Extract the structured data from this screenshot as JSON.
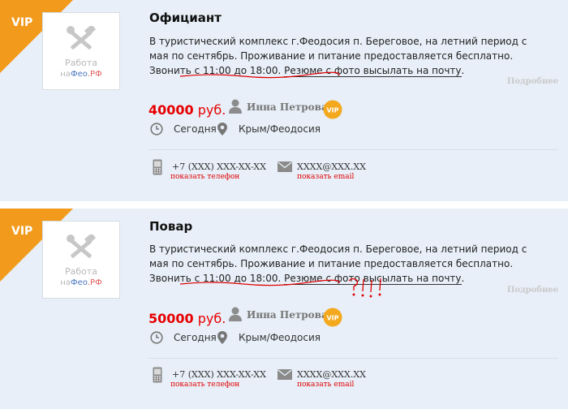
{
  "colors": {
    "vip_ribbon": "#f29a1c",
    "card_bg": "#e8eff8",
    "price": "#e60000",
    "link_red": "#e00000",
    "annotation": "#e00000"
  },
  "logo": {
    "line1": "Работа",
    "na": "на",
    "feo": "Фео",
    "rf": ".РФ",
    "icon": "tools-icon"
  },
  "listings": [
    {
      "vip": "VIP",
      "title": "Официант",
      "desc_before": "В туристический комплекс г.Феодосия п. Береговое, на летний период с мая по сентябрь. Проживание и питание предоставляется бесплатно. Звонить с 11:00 до 18:00. ",
      "desc_highlight": "Резюме с фото высылать на почту",
      "desc_after": ".",
      "more": "Подробнее",
      "price_value": "40000",
      "price_unit": "руб.",
      "person": "Инна Петрова",
      "person_badge": "VIP",
      "date": "Сегодня",
      "location": "Крым/Феодосия",
      "phone": "+7 (XXX) XXX-XX-XX",
      "show_phone": "показать телефон",
      "email": "XXXX@XXX.XX",
      "show_email": "показать email"
    },
    {
      "vip": "VIP",
      "title": "Повар",
      "desc_before": "В туристический комплекс  г.Феодосия п. Береговое, на летний период с мая по сентябрь. Проживание и питание предоставляется бесплатно.  Звонить с 11:00 до 18:00. ",
      "desc_highlight": "Резюме с фото высылать на почту",
      "desc_after": ".",
      "more": "Подробнее",
      "price_value": "50000",
      "price_unit": "руб.",
      "person": "Инна Петрова",
      "person_badge": "VIP",
      "date": "Сегодня",
      "location": "Крым/Феодосия",
      "phone": "+7 (XXX) XXX-XX-XX",
      "show_phone": "показать телефон",
      "email": "XXXX@XXX.XX",
      "show_email": "показать email"
    }
  ]
}
